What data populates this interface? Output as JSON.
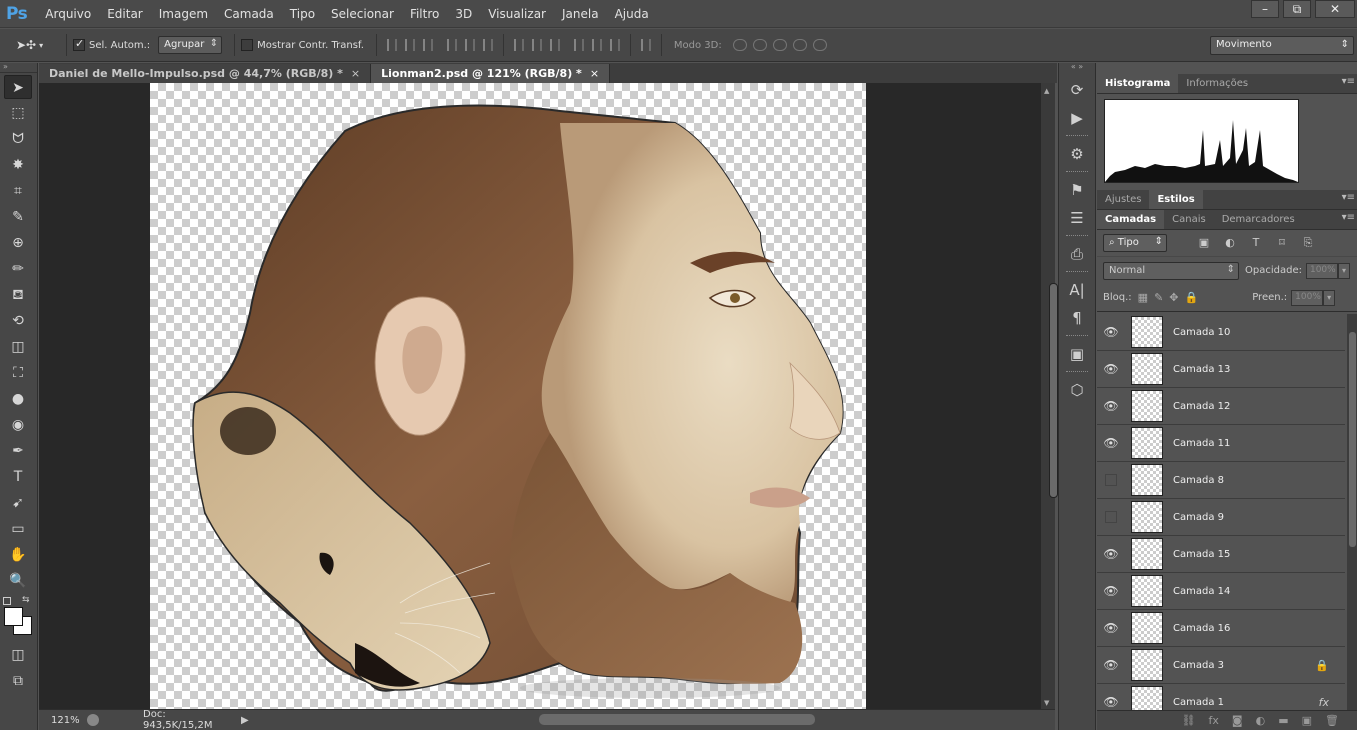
{
  "app": {
    "logo": "Ps",
    "menu": [
      "Arquivo",
      "Editar",
      "Imagem",
      "Camada",
      "Tipo",
      "Selecionar",
      "Filtro",
      "3D",
      "Visualizar",
      "Janela",
      "Ajuda"
    ],
    "window_controls": [
      "–",
      "⧉",
      "✕"
    ]
  },
  "options": {
    "auto_select_label": "Sel. Autom.:",
    "auto_select_checked": true,
    "group_select": "Agrupar",
    "show_transform_label": "Mostrar Contr. Transf.",
    "show_transform_checked": false,
    "mode_3d_label": "Modo 3D:",
    "workspace": "Movimento"
  },
  "tabs": [
    {
      "title": "Daniel de Mello-Impulso.psd @ 44,7% (RGB/8) *",
      "close": "×",
      "active": false
    },
    {
      "title": "Lionman2.psd @ 121% (RGB/8) *",
      "close": "×",
      "active": true
    }
  ],
  "tools": [
    "move-tool-icon",
    "marquee-tool-icon",
    "lasso-tool-icon",
    "magic-wand-tool-icon",
    "crop-tool-icon",
    "eyedropper-tool-icon",
    "healing-brush-tool-icon",
    "brush-tool-icon",
    "clone-stamp-tool-icon",
    "history-brush-tool-icon",
    "eraser-tool-icon",
    "paint-bucket-tool-icon",
    "blur-tool-icon",
    "dodge-tool-icon",
    "pen-tool-icon",
    "type-tool-icon",
    "path-selection-tool-icon",
    "rectangle-tool-icon",
    "hand-tool-icon",
    "zoom-tool-icon"
  ],
  "tool_glyphs": [
    "➤",
    "⬚",
    "ᗢ",
    "✸",
    "⌗",
    "✎",
    "⊕",
    "✏",
    "⛾",
    "⟲",
    "◫",
    "⛶",
    "●",
    "◉",
    "✒",
    "T",
    "➹",
    "▭",
    "✋",
    "🔍"
  ],
  "status": {
    "zoom": "121%",
    "doc": "Doc: 943,5K/15,2M",
    "arrow": "▶"
  },
  "dock_icons": [
    "history-icon",
    "actions-icon",
    "swatches-icon",
    "brush-presets-icon",
    "tool-presets-icon",
    "clone-source-icon",
    "character-icon",
    "paragraph-icon",
    "layer-comps-icon",
    "3d-icon"
  ],
  "dock_glyphs": [
    "⟳",
    "▶",
    "⚙",
    "⚑",
    "☰",
    "⎙",
    "A|",
    "¶",
    "▣",
    "⬡"
  ],
  "histogram_panel": {
    "tabs": [
      "Histograma",
      "Informações"
    ]
  },
  "adjust_panel": {
    "tabs": [
      "Ajustes",
      "Estilos"
    ]
  },
  "layers_panel": {
    "tabs": [
      "Camadas",
      "Canais",
      "Demarcadores"
    ],
    "kind_filter": "Tipo",
    "blend_mode": "Normal",
    "opacity_label": "Opacidade:",
    "opacity_value": "100%",
    "lock_label": "Bloq.:",
    "fill_label": "Preen.:",
    "fill_value": "100%",
    "layers": [
      {
        "name": "Camada 10",
        "visible": true
      },
      {
        "name": "Camada 13",
        "visible": true
      },
      {
        "name": "Camada 12",
        "visible": true
      },
      {
        "name": "Camada 11",
        "visible": true
      },
      {
        "name": "Camada 8",
        "visible": false
      },
      {
        "name": "Camada 9",
        "visible": false
      },
      {
        "name": "Camada 15",
        "visible": true
      },
      {
        "name": "Camada 14",
        "visible": true
      },
      {
        "name": "Camada 16",
        "visible": true
      },
      {
        "name": "Camada 3",
        "visible": true,
        "locked": true
      },
      {
        "name": "Camada 1",
        "visible": true,
        "fx": "fx"
      }
    ]
  },
  "colors": {
    "accent": "#4fa3e6",
    "panel": "#535353",
    "fg_swatch": "#ffffff",
    "bg_swatch": "#ffffff"
  }
}
